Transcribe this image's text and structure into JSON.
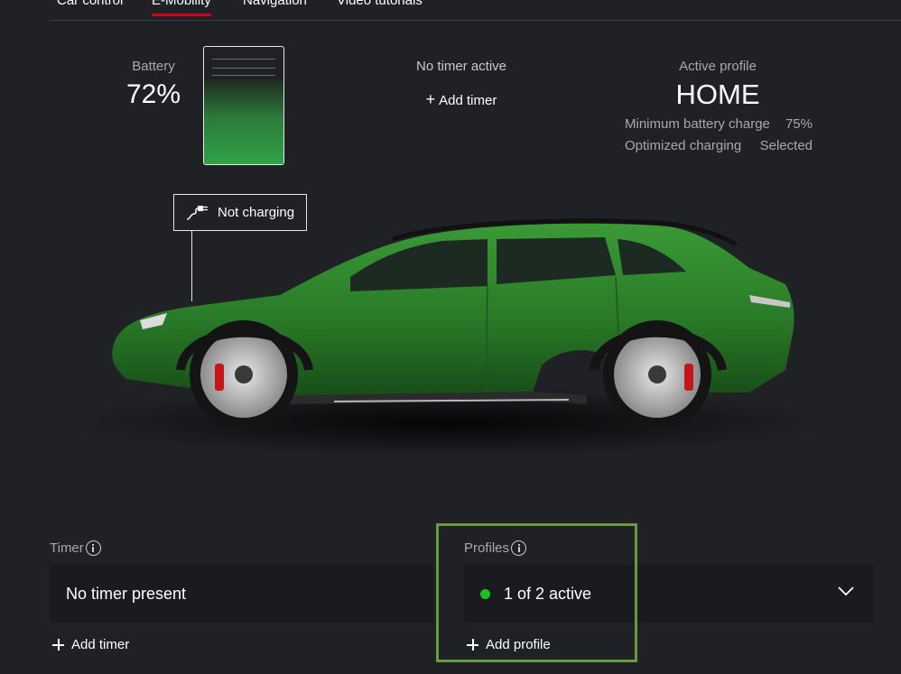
{
  "nav": {
    "tabs": [
      {
        "label": "Car control"
      },
      {
        "label": "E-Mobility",
        "active": true
      },
      {
        "label": "Navigation"
      },
      {
        "label": "Video tutorials"
      }
    ]
  },
  "battery": {
    "label": "Battery",
    "value": "72%",
    "level": 0.72
  },
  "timer_summary": {
    "status": "No timer active",
    "add_label": "Add timer"
  },
  "active_profile": {
    "label": "Active profile",
    "name": "HOME",
    "min_charge_label": "Minimum battery charge",
    "min_charge_value": "75%",
    "optimized_label": "Optimized charging",
    "optimized_value": "Selected"
  },
  "charging": {
    "status": "Not charging",
    "icon": "plug-icon"
  },
  "timer_section": {
    "label": "Timer",
    "value": "No timer present",
    "add_label": "Add timer"
  },
  "profiles_section": {
    "label": "Profiles",
    "value": "1 of 2 active",
    "add_label": "Add profile",
    "status_color": "#1fc01f"
  },
  "colors": {
    "accent": "#d5001c",
    "background": "#1f2125",
    "highlight": "#6a9a3f",
    "car": "#2f7d2d"
  }
}
